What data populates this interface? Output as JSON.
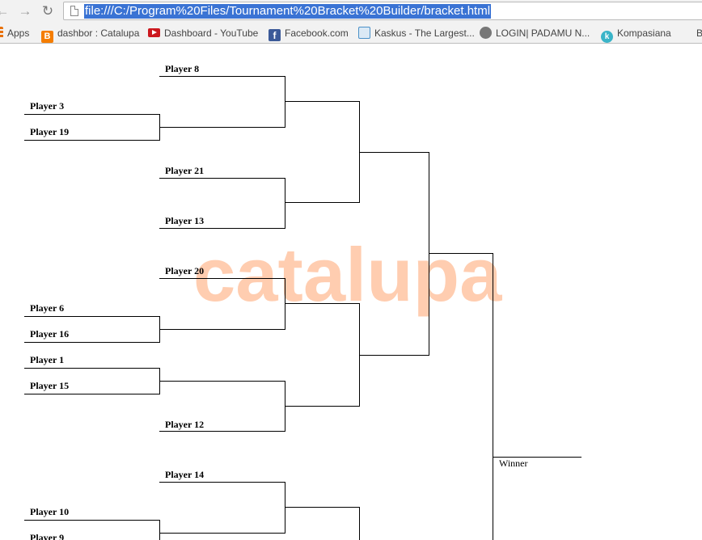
{
  "browser": {
    "url": "file:///C:/Program%20Files/Tournament%20Bracket%20Builder/bracket.html",
    "bookmarks": [
      {
        "label": "Apps",
        "icon": "apps-grid-icon",
        "color": "#e8710a"
      },
      {
        "label": "dashbor : Catalupa",
        "icon": "blogger-icon",
        "color": "#f57d00"
      },
      {
        "label": "Dashboard - YouTube",
        "icon": "youtube-icon",
        "color": "#cc181e"
      },
      {
        "label": "Facebook.com",
        "icon": "facebook-icon",
        "color": "#3b5998"
      },
      {
        "label": "Kaskus - The Largest...",
        "icon": "kaskus-icon",
        "color": "#4a90c8"
      },
      {
        "label": "LOGIN| PADAMU N...",
        "icon": "garuda-icon",
        "color": "#555555"
      },
      {
        "label": "Kompasiana",
        "icon": "kompasiana-icon",
        "color": "#3ab4c8"
      },
      {
        "label": "B",
        "icon": "",
        "color": ""
      }
    ]
  },
  "watermark": "catalupa",
  "bracket": {
    "round1": {
      "slot_3": "Player 3",
      "slot_4": "Player 19",
      "slot_11": "Player 6",
      "slot_12": "Player 16",
      "slot_13": "Player 1",
      "slot_14": "Player 15",
      "slot_19": "Player 10",
      "slot_20": "Player 9"
    },
    "round2": {
      "slot_1": "Player 8",
      "slot_3": "Player 21",
      "slot_4": "Player 13",
      "slot_5": "Player 20",
      "slot_8": "Player 12",
      "slot_9": "Player 14"
    },
    "final_label": "Winner"
  }
}
